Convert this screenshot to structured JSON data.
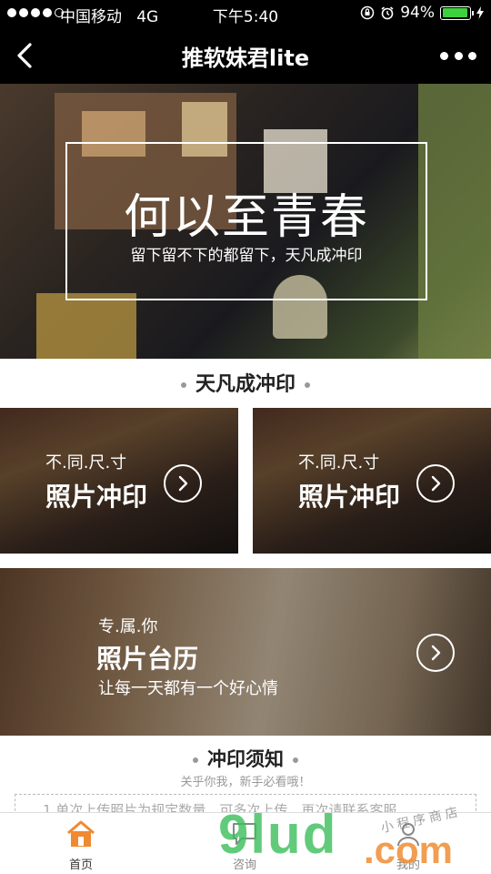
{
  "status_bar": {
    "carrier": "中国移动",
    "network": "4G",
    "time": "下午5:40",
    "battery": "94%",
    "battery_level": 0.94
  },
  "nav": {
    "title": "推软妹君lite"
  },
  "hero": {
    "title": "何以至青春",
    "subtitle": "留下留不下的都留下，天凡成冲印"
  },
  "section1": {
    "title": "天凡成冲印"
  },
  "cards": [
    {
      "small": "不.同.尺.寸",
      "big": "照片冲印"
    },
    {
      "small": "不.同.尺.寸",
      "big": "照片冲印"
    },
    {
      "small": "专.属.你",
      "big": "照片台历",
      "line": "让每一天都有一个好心情"
    }
  ],
  "section2": {
    "title": "冲印须知",
    "subtitle": "关乎你我，新手必看哦！",
    "preview_text": "1.单次上传照片为规定数量，可多次上传，再次请联系客服"
  },
  "tabs": [
    {
      "label": "首页",
      "icon": "home-icon",
      "active": true
    },
    {
      "label": "咨询",
      "icon": "chat-icon",
      "active": false
    },
    {
      "label": "我的",
      "icon": "user-icon",
      "active": false
    }
  ],
  "watermark": {
    "brand": "9lud",
    "suffix": ".com",
    "shop": "小程序商店"
  },
  "colors": {
    "accent": "#f08a30",
    "tab_inactive": "#888888",
    "watermark_green": "#3abe5a"
  }
}
